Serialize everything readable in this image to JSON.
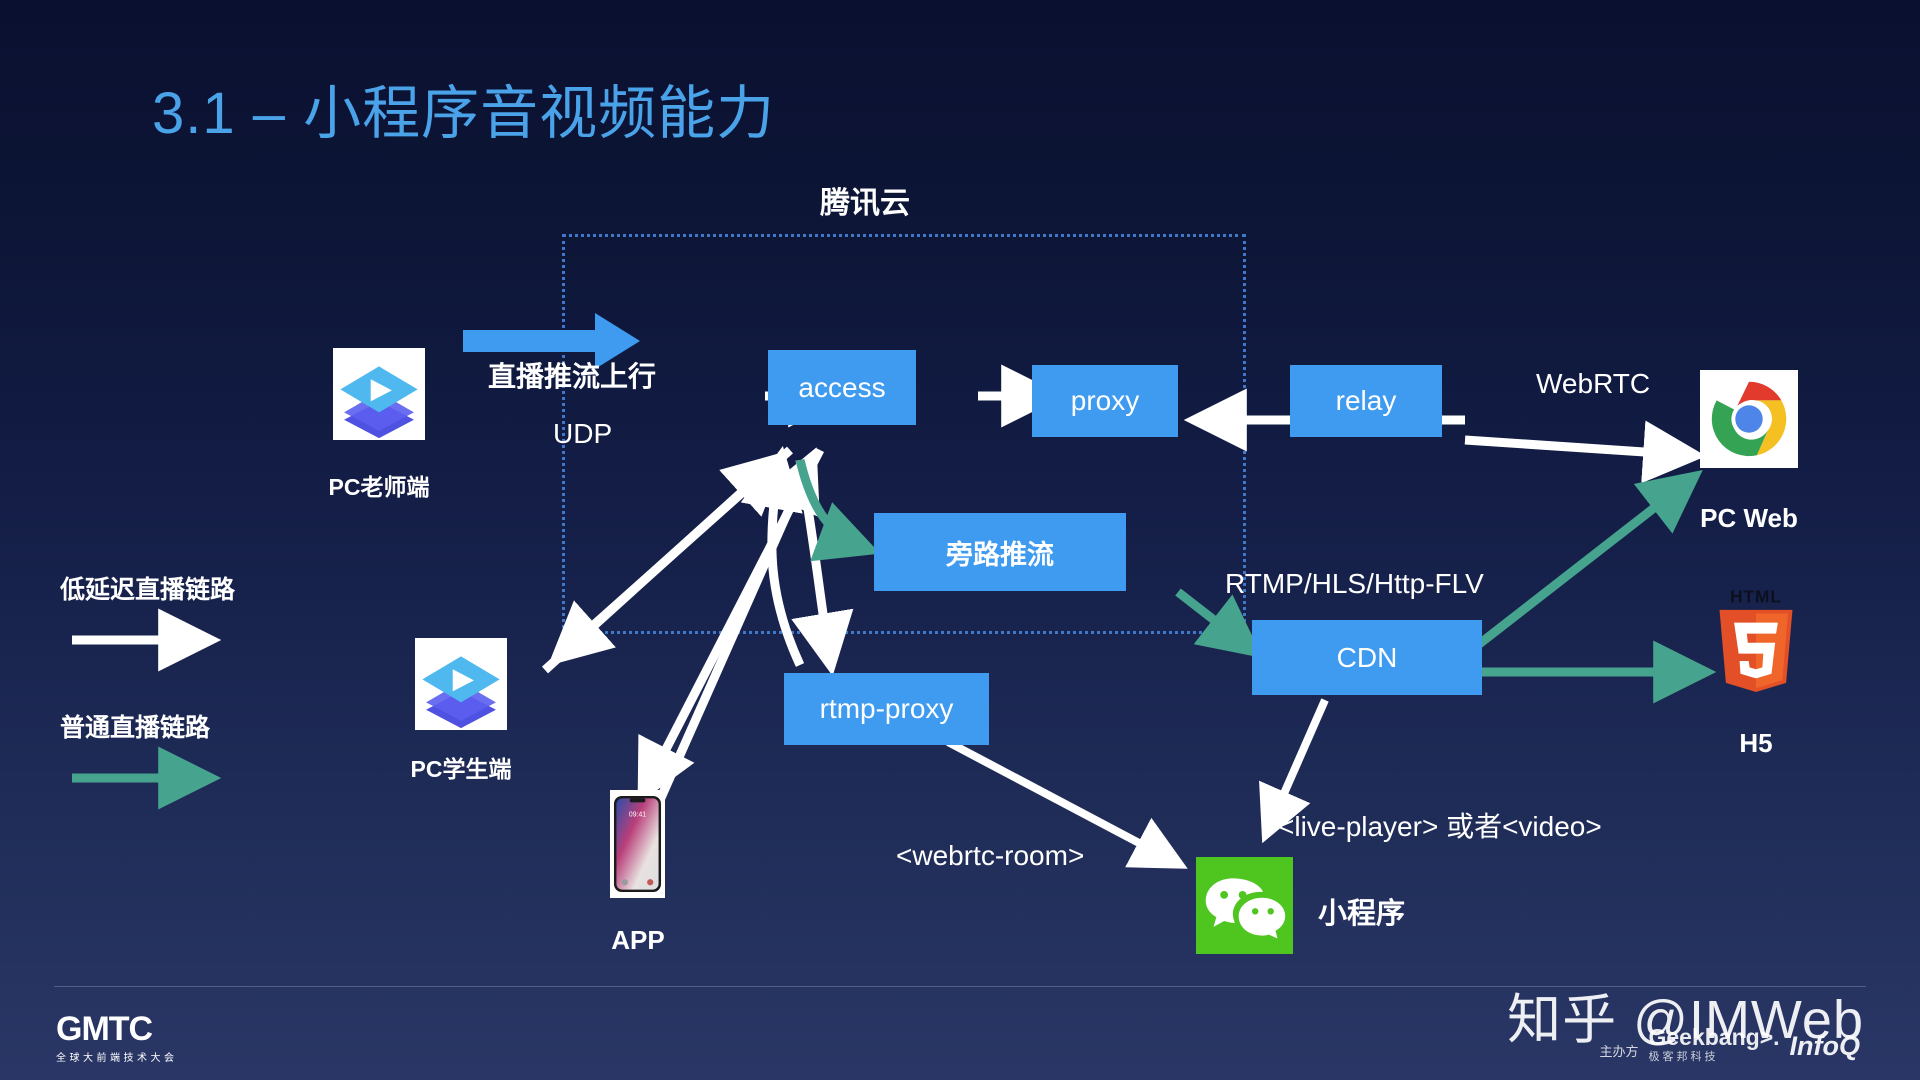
{
  "slide": {
    "title": "3.1 – 小程序音视频能力",
    "title_color": "#4aa3e8",
    "background_top": "#0a1030",
    "background_bottom": "#2a3766"
  },
  "cloud": {
    "label": "腾讯云",
    "border_color": "#3f78c8"
  },
  "nodes": {
    "access": "access",
    "proxy": "proxy",
    "relay": "relay",
    "bypass": "旁路推流",
    "rtmp_proxy": "rtmp-proxy",
    "cdn": "CDN",
    "node_color": "#3e9bf0"
  },
  "endpoints": {
    "pc_teacher": "PC老师端",
    "pc_student": "PC学生端",
    "app": "APP",
    "pc_web": "PC Web",
    "h5": "H5",
    "miniprogram": "小程序"
  },
  "icons": {
    "pc_teacher": "education-play-icon",
    "pc_student": "education-play-icon",
    "app": "iphone-icon",
    "pc_web": "chrome-icon",
    "h5": "html5-icon",
    "miniprogram": "wechat-icon"
  },
  "edge_labels": {
    "push_upstream": "直播推流上行",
    "udp": "UDP",
    "webrtc": "WebRTC",
    "rtmp_hls_flv": "RTMP/HLS/Http-FLV",
    "webrtc_room": "<webrtc-room>",
    "live_player": "<live-player> 或者<video>"
  },
  "legend": {
    "low_latency": {
      "label": "低延迟直播链路",
      "color": "#ffffff"
    },
    "normal": {
      "label": "普通直播链路",
      "color": "#46a38e"
    }
  },
  "footer": {
    "gmtc_word": "GMTC",
    "gmtc_sub": "全球大前端技术大会",
    "watermark": "知乎 @IMWeb",
    "organizer_tag": "主办方",
    "geekbang_main": "Geekbang>.",
    "geekbang_sub": "极客邦科技",
    "infoq": "InfoQ"
  }
}
